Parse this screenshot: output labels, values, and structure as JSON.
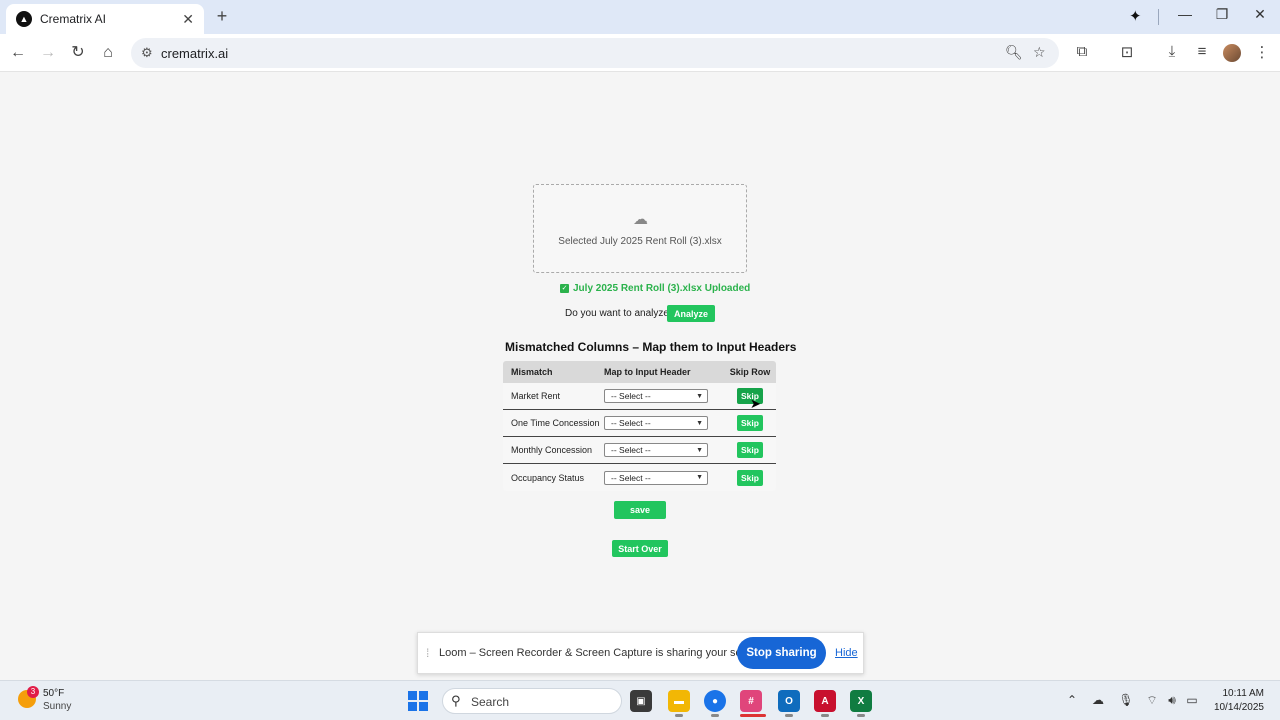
{
  "browser": {
    "tab_title": "Crematrix AI",
    "url": "crematrix.ai"
  },
  "upload": {
    "dropzone_text": "Selected July 2025 Rent Roll (3).xlsx",
    "uploaded_text": "July 2025 Rent Roll (3).xlsx Uploaded",
    "question": "Do you want to analyze?",
    "analyze_label": "Analyze"
  },
  "mapping": {
    "title": "Mismatched Columns – Map them to Input Headers",
    "headers": [
      "Mismatch",
      "Map to Input Header",
      "Skip Row"
    ],
    "rows": [
      {
        "mismatch": "Market Rent",
        "select": "-- Select --",
        "skip": "Skip"
      },
      {
        "mismatch": "One Time Concession",
        "select": "-- Select --",
        "skip": "Skip"
      },
      {
        "mismatch": "Monthly Concession",
        "select": "-- Select --",
        "skip": "Skip"
      },
      {
        "mismatch": "Occupancy Status",
        "select": "-- Select --",
        "skip": "Skip"
      }
    ],
    "save_label": "save",
    "start_over_label": "Start Over"
  },
  "loom": {
    "message": "Loom – Screen Recorder & Screen Capture is sharing your screen.",
    "stop_label": "Stop sharing",
    "hide_label": "Hide"
  },
  "taskbar": {
    "weather_badge": "3",
    "temperature": "50°F",
    "condition": "Sunny",
    "search_label": "Search",
    "time": "10:11 AM",
    "date": "10/14/2025"
  },
  "colors": {
    "accent_green": "#22c55e",
    "loom_blue": "#1766d6"
  }
}
